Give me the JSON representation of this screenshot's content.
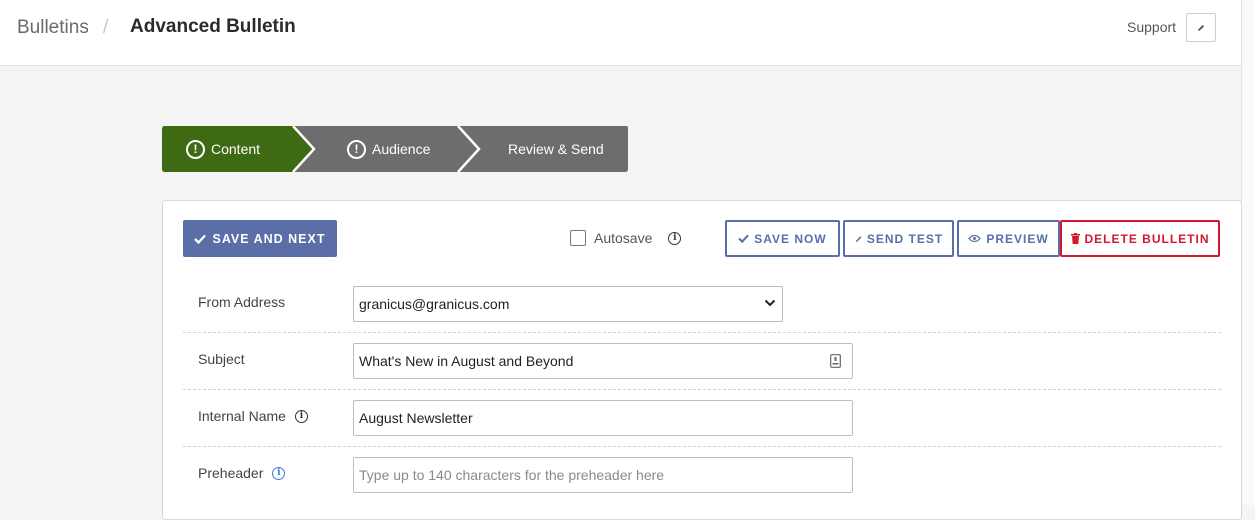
{
  "header": {
    "breadcrumb_root": "Bulletins",
    "breadcrumb_separator": "/",
    "page_title": "Advanced Bulletin",
    "support_label": "Support",
    "support_icon": "pencil-icon"
  },
  "steps": [
    {
      "label": "Content",
      "icon": "alert-circle-icon",
      "state": "active",
      "color": "#3d6a13"
    },
    {
      "label": "Audience",
      "icon": "alert-circle-icon",
      "state": "inactive",
      "color": "#6d6d6d"
    },
    {
      "label": "Review & Send",
      "icon": "",
      "state": "inactive",
      "color": "#6d6d6d"
    }
  ],
  "toolbar": {
    "save_next_label": "SAVE AND NEXT",
    "autosave_label": "Autosave",
    "autosave_checked": false,
    "save_now_label": "SAVE NOW",
    "send_test_label": "SEND TEST",
    "preview_label": "PREVIEW",
    "delete_label": "DELETE BULLETIN"
  },
  "form": {
    "from_address": {
      "label": "From Address",
      "value": "granicus@granicus.com"
    },
    "subject": {
      "label": "Subject",
      "value": "What's New in August and Beyond"
    },
    "internal_name": {
      "label": "Internal Name",
      "value": "August Newsletter"
    },
    "preheader": {
      "label": "Preheader",
      "value": "",
      "placeholder": "Type up to 140 characters for the preheader here"
    }
  },
  "colors": {
    "primary": "#5b6ea7",
    "danger": "#d0192d",
    "step_active": "#3d6a13",
    "step_inactive": "#6d6d6d",
    "info_blue": "#3c7ad6"
  }
}
